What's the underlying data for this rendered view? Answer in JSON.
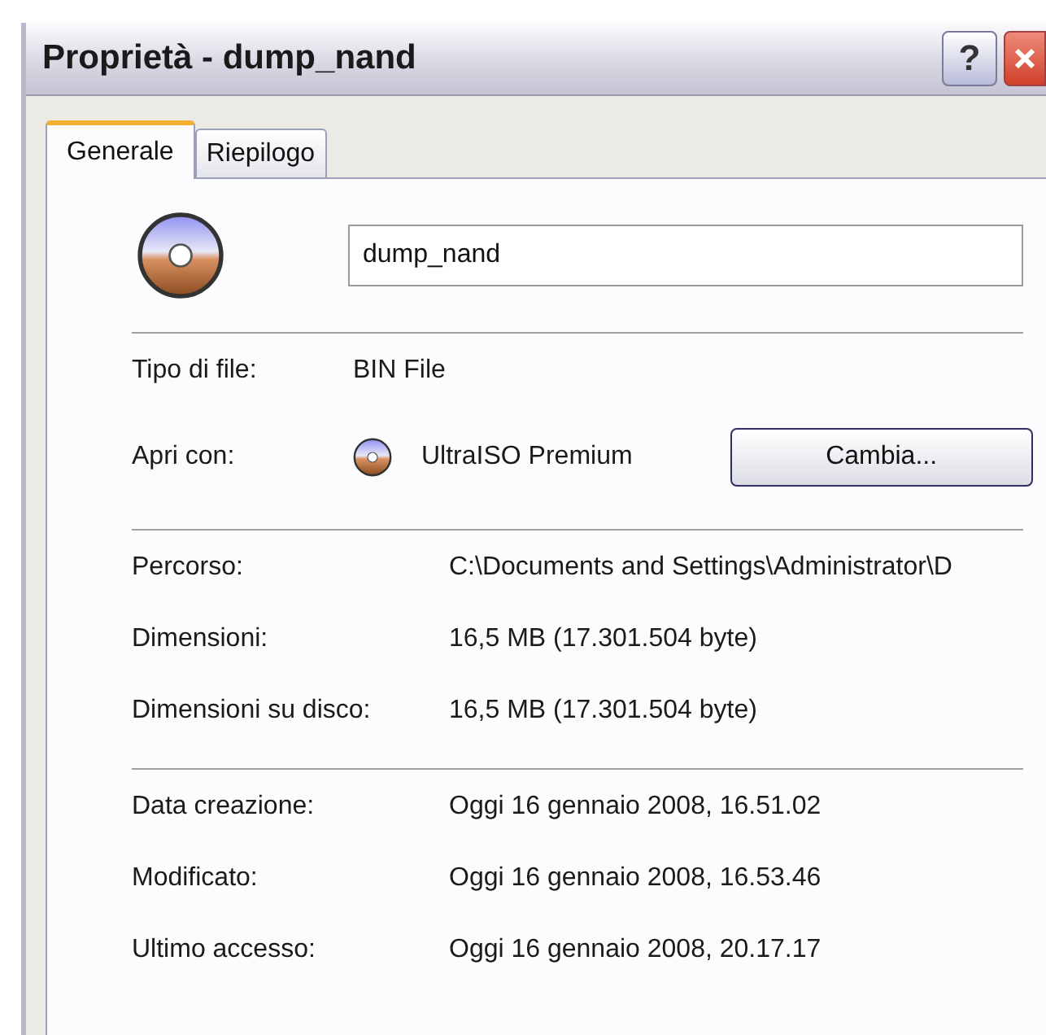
{
  "window": {
    "title": "Proprietà - dump_nand",
    "help_button": "?"
  },
  "tabs": [
    {
      "label": "Generale",
      "selected": true
    },
    {
      "label": "Riepilogo",
      "selected": false
    }
  ],
  "general": {
    "file_name": "dump_nand",
    "groups": [
      {
        "rows": [
          {
            "kind": "text",
            "label": "Tipo di file:",
            "value": "BIN File"
          },
          {
            "kind": "app",
            "label": "Apri con:",
            "value": "UltraISO Premium",
            "button": "Cambia..."
          }
        ]
      },
      {
        "rows": [
          {
            "kind": "text",
            "label": "Percorso:",
            "value": "C:\\Documents and Settings\\Administrator\\D"
          },
          {
            "kind": "text",
            "label": "Dimensioni:",
            "value": "16,5 MB (17.301.504 byte)"
          },
          {
            "kind": "text",
            "label": "Dimensioni su disco:",
            "value": "16,5 MB (17.301.504 byte)"
          }
        ]
      },
      {
        "rows": [
          {
            "kind": "text",
            "label": "Data creazione:",
            "value": "Oggi 16 gennaio 2008, 16.51.02"
          },
          {
            "kind": "text",
            "label": "Modificato:",
            "value": "Oggi 16 gennaio 2008, 16.53.46"
          },
          {
            "kind": "text",
            "label": "Ultimo accesso:",
            "value": "Oggi 16 gennaio 2008, 20.17.17"
          }
        ]
      }
    ]
  }
}
